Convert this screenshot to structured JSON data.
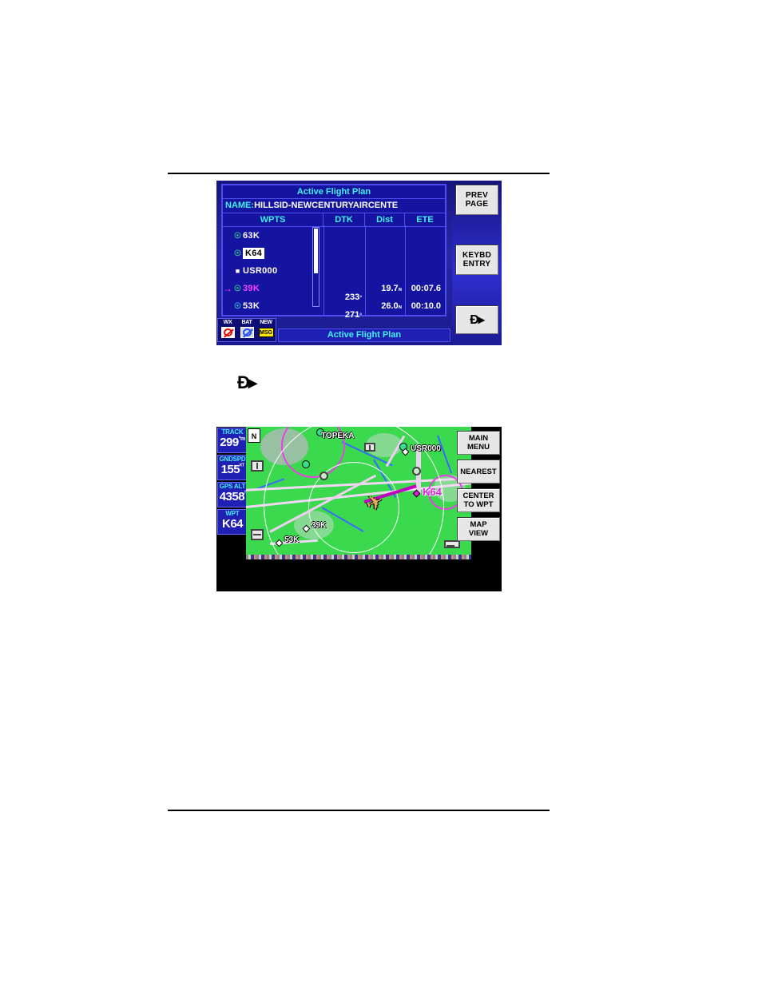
{
  "figure1": {
    "name": "active-flight-plan-screen",
    "panel_title": "Active Flight Plan",
    "name_label": "NAME:",
    "name_value": "HILLSID-NEWCENTURYAIRCENTE",
    "columns": [
      "WPTS",
      "DTK",
      "Dist",
      "ETE"
    ],
    "rows": [
      {
        "arrow": "",
        "icon": "airport-icon",
        "id": "63K",
        "selected": false,
        "active": false,
        "dtk": "",
        "dtk_unit": "",
        "dist": "",
        "dist_unit": "",
        "ete": ""
      },
      {
        "arrow": "",
        "icon": "airport-icon",
        "id": "K64",
        "selected": true,
        "active": false,
        "dtk": "",
        "dtk_unit": "",
        "dist": "",
        "dist_unit": "",
        "ete": ""
      },
      {
        "arrow": "",
        "icon": "user-waypoint-icon",
        "id": "USR000",
        "selected": false,
        "active": false,
        "dtk": "",
        "dtk_unit": "",
        "dist": "",
        "dist_unit": "",
        "ete": ""
      },
      {
        "arrow": "→",
        "icon": "airport-icon",
        "id": "39K",
        "selected": false,
        "active": true,
        "dtk": "233",
        "dtk_unit": "°",
        "dist": "19.7",
        "dist_unit": "ɴ",
        "ete": "00:07.6"
      },
      {
        "arrow": "",
        "icon": "airport-icon-cyan",
        "id": "53K",
        "selected": false,
        "active": false,
        "dtk": "271",
        "dtk_unit": "°",
        "dist": "26.0",
        "dist_unit": "ɴ",
        "ete": "00:10.0"
      }
    ],
    "softkeys": [
      {
        "name": "prev-page-button",
        "line1": "PREV",
        "line2": "PAGE"
      },
      {
        "name": "keybd-entry-button",
        "line1": "KEYBD",
        "line2": "ENTRY"
      },
      {
        "name": "direct-to-button",
        "glyph": "Đ▸"
      }
    ],
    "status": {
      "items": [
        {
          "label": "WX",
          "icon": "wx-unavailable-icon"
        },
        {
          "label": "BAT",
          "icon": "battery-unavailable-icon"
        },
        {
          "label": "NEW",
          "icon": "msg-icon",
          "badge": "MSG"
        }
      ]
    },
    "bottom_bar": "Active Flight Plan"
  },
  "callout": {
    "name": "direct-to-icon",
    "glyph": "Đ▸"
  },
  "figure2": {
    "name": "moving-map-screen",
    "data_fields": [
      {
        "name": "track-field",
        "label": "TRACK",
        "value": "299",
        "unit": "°m"
      },
      {
        "name": "gndspd-field",
        "label": "GNDSPD",
        "value": "155",
        "unit": "ᴷᵀ"
      },
      {
        "name": "gps-alt-field",
        "label": "GPS ALT",
        "value": "4358",
        "unit": "ᶠ"
      },
      {
        "name": "wpt-field",
        "label": "WPT",
        "value": "K64",
        "unit": ""
      }
    ],
    "softkeys": [
      {
        "name": "main-menu-button",
        "line1": "MAIN",
        "line2": "MENU"
      },
      {
        "name": "nearest-button",
        "line1": "NEAREST",
        "line2": ""
      },
      {
        "name": "center-to-wpt-button",
        "line1": "CENTER",
        "line2": "TO WPT"
      },
      {
        "name": "map-view-button",
        "line1": "MAP",
        "line2": "VIEW"
      }
    ],
    "map_labels": [
      {
        "name": "map-label-topeka",
        "text": "TOPEKA",
        "color": "white"
      },
      {
        "name": "map-label-usr000",
        "text": "USR000",
        "color": "white"
      },
      {
        "name": "map-label-k64",
        "text": "K64",
        "color": "magenta"
      },
      {
        "name": "map-label-39k",
        "text": "39K",
        "color": "white"
      },
      {
        "name": "map-label-53k",
        "text": "53K",
        "color": "white"
      }
    ],
    "north_indicator": "N"
  },
  "colors": {
    "screen_blue": "#1414a0",
    "cyan_text": "#45f0f0",
    "magenta": "#ff40ff",
    "map_green": "#3ad94e",
    "softkey_face": "#e6e6e6"
  }
}
